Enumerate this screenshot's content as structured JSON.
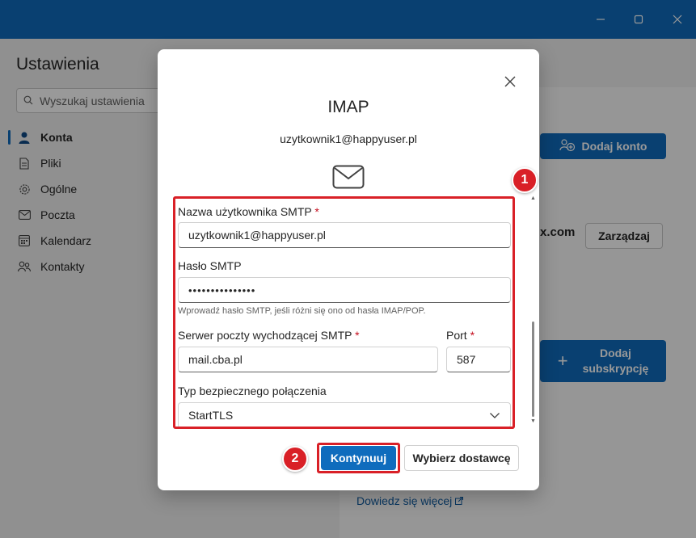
{
  "settings": {
    "title": "Ustawienia",
    "search_placeholder": "Wyszukaj ustawienia",
    "nav": [
      {
        "label": "Konta",
        "icon": "person-icon",
        "active": true
      },
      {
        "label": "Pliki",
        "icon": "file-icon",
        "active": false
      },
      {
        "label": "Ogólne",
        "icon": "gear-icon",
        "active": false
      },
      {
        "label": "Poczta",
        "icon": "mail-icon",
        "active": false
      },
      {
        "label": "Kalendarz",
        "icon": "calendar-icon",
        "active": false
      },
      {
        "label": "Kontakty",
        "icon": "contacts-icon",
        "active": false
      }
    ]
  },
  "background_panel": {
    "add_account_label": "Dodaj konto",
    "domain_fragment": "x.com",
    "manage_label": "Zarządzaj",
    "add_subscription_label_1": "Dodaj",
    "add_subscription_label_2": "subskrypcję",
    "learn_more_label": "Dowiedz się więcej"
  },
  "dialog": {
    "title": "IMAP",
    "email": "uzytkownik1@happyuser.pl",
    "smtp_username_label": "Nazwa użytkownika SMTP",
    "smtp_username_value": "uzytkownik1@happyuser.pl",
    "smtp_password_label": "Hasło SMTP",
    "smtp_password_value": "•••••••••••••••",
    "smtp_password_hint": "Wprowadź hasło SMTP, jeśli różni się ono od hasła IMAP/POP.",
    "smtp_server_label": "Serwer poczty wychodzącej SMTP",
    "smtp_server_value": "mail.cba.pl",
    "port_label": "Port",
    "port_value": "587",
    "security_label": "Typ bezpiecznego połączenia",
    "security_value": "StartTLS",
    "required_mark": "*",
    "continue_label": "Kontynuuj",
    "choose_provider_label": "Wybierz dostawcę"
  },
  "annotations": {
    "badge_1": "1",
    "badge_2": "2"
  },
  "colors": {
    "accent": "#0f6cbd",
    "annotation_red": "#d92027"
  }
}
